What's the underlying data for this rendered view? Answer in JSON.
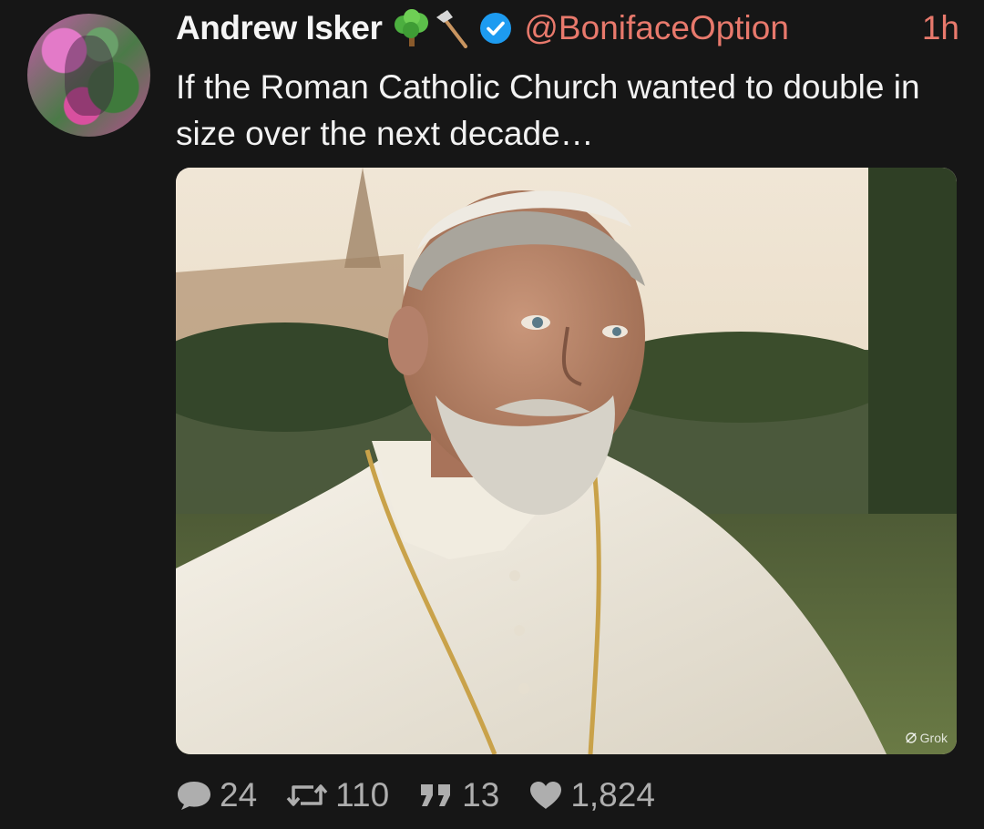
{
  "post": {
    "author_name": "Andrew Isker",
    "author_emojis": [
      "tree-emoji",
      "axe-emoji"
    ],
    "verified": true,
    "handle": "@BonifaceOption",
    "time": "1h",
    "text": "If the Roman Catholic Church wanted to double in size over the next decade…",
    "media": {
      "watermark": "Grok"
    },
    "stats": {
      "replies": "24",
      "reposts": "110",
      "quotes": "13",
      "likes": "1,824"
    }
  },
  "colors": {
    "background": "#161616",
    "accent": "#e8796c",
    "verified_blue": "#1d9bf0",
    "muted": "#aeaeae"
  }
}
